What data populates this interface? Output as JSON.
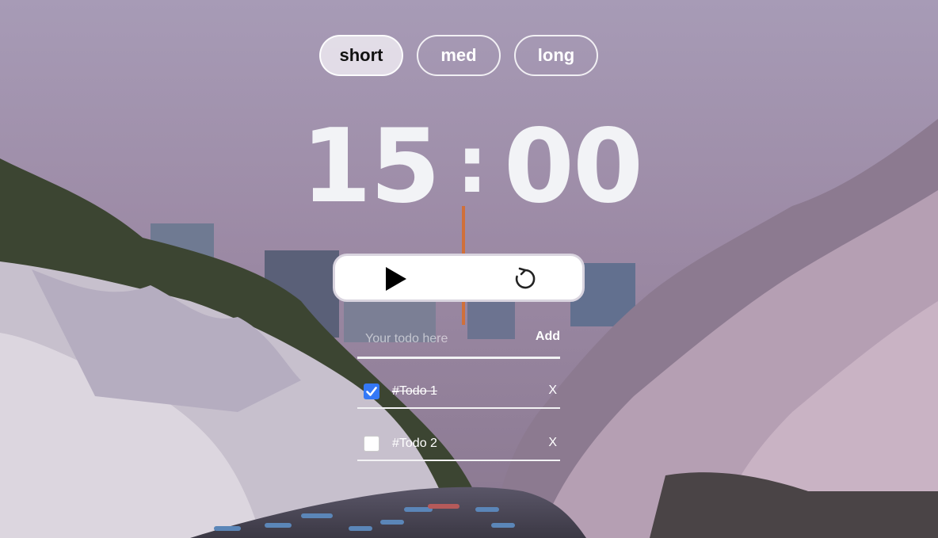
{
  "modes": {
    "items": [
      {
        "label": "short",
        "active": true
      },
      {
        "label": "med",
        "active": false
      },
      {
        "label": "long",
        "active": false
      }
    ]
  },
  "timer": {
    "minutes": "15",
    "separator": ":",
    "seconds": "00"
  },
  "controls": {
    "play_icon": "play-icon",
    "reset_icon": "reset-icon"
  },
  "todo_form": {
    "placeholder": "Your todo here",
    "value": "",
    "add_label": "Add"
  },
  "todos": [
    {
      "text": "#Todo 1",
      "checked": true,
      "delete_label": "X"
    },
    {
      "text": "#Todo 2",
      "checked": false,
      "delete_label": "X"
    }
  ],
  "colors": {
    "checkbox_accent": "#3478f6",
    "timer_text": "#f2f3f6"
  }
}
